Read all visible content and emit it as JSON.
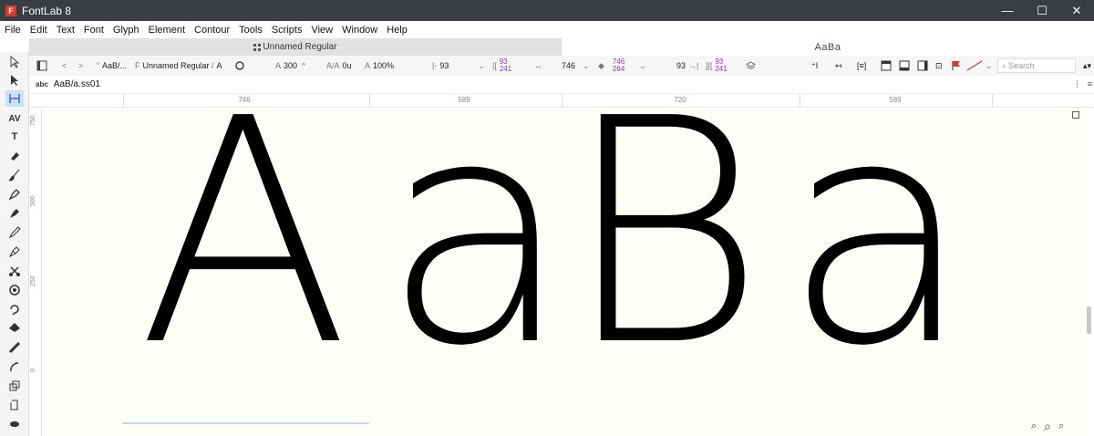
{
  "window": {
    "title": "FontLab 8",
    "app_icon": "F"
  },
  "window_controls": {
    "minimize": "—",
    "maximize": "☐",
    "close": "✕"
  },
  "menu": [
    "File",
    "Edit",
    "Text",
    "Font",
    "Glyph",
    "Element",
    "Contour",
    "Tools",
    "Scripts",
    "View",
    "Window",
    "Help"
  ],
  "tabs": {
    "font_window": "Unnamed Regular",
    "glyph_window": "AaBa"
  },
  "propbar": {
    "text_label": "AaB/...",
    "font_name": "Unnamed Regular",
    "glyph_name": "A",
    "weight": "300",
    "tracking": "0u",
    "zoom": "100%",
    "lsb": "93",
    "rsb_top": "93",
    "rsb_bottom": "241",
    "advance": "746",
    "metric_top": "746",
    "metric_bottom": "264",
    "width2": "93",
    "width3_top": "93",
    "width3_bottom": "241",
    "search_placeholder": "Search"
  },
  "text_row": {
    "abc": "abc",
    "text": "AaB/a.ss01"
  },
  "ruler": {
    "marks": [
      "746",
      "589",
      "720",
      "589"
    ]
  },
  "vruler": {
    "marks": [
      "750",
      "500",
      "250",
      "0"
    ]
  },
  "glyphs": [
    "A",
    "a",
    "B",
    "a"
  ],
  "icons": {
    "tools": [
      "pointer-icon",
      "contour-pointer-icon",
      "metrics-icon",
      "kerning-icon",
      "text-icon",
      "eraser-icon",
      "brush-icon",
      "pen-icon",
      "rapid-pen-icon",
      "pencil-icon",
      "power-nib-icon",
      "knife-icon",
      "rotate-icon",
      "rubber-band-icon",
      "fill-icon",
      "ruler-icon",
      "arc-icon",
      "transform-icon",
      "copy-icon",
      "hand-icon"
    ]
  },
  "colors": {
    "titlebar": "#3a3d41",
    "canvas": "#fefef9",
    "accent_purple": "#8d3aa7",
    "flag_red": "#d43a2f"
  }
}
